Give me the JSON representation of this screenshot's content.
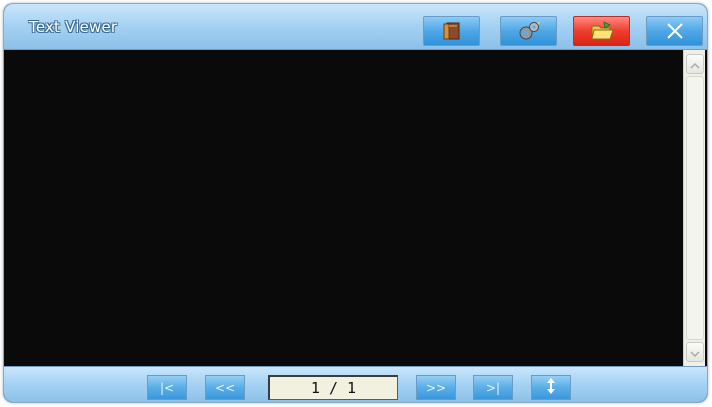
{
  "window": {
    "title": "Text Viewer"
  },
  "titlebar": {
    "buttons": [
      {
        "icon": "book-icon",
        "label": ""
      },
      {
        "icon": "gears-icon",
        "label": ""
      },
      {
        "icon": "folder-open-icon",
        "label": "",
        "color": "#ef3d2e"
      },
      {
        "icon": "close-icon",
        "label": ""
      }
    ]
  },
  "content": {
    "text": "",
    "background": "#0a0a0a"
  },
  "navigation": {
    "first_glyph": "|<",
    "prev_glyph": "<<",
    "page_indicator": "1 / 1",
    "next_glyph": ">>",
    "last_glyph": ">|",
    "scroll_icon": "vertical-scroll-icon"
  },
  "colors": {
    "accent": "#4fa7e6",
    "frame": "#a4d1f2"
  }
}
